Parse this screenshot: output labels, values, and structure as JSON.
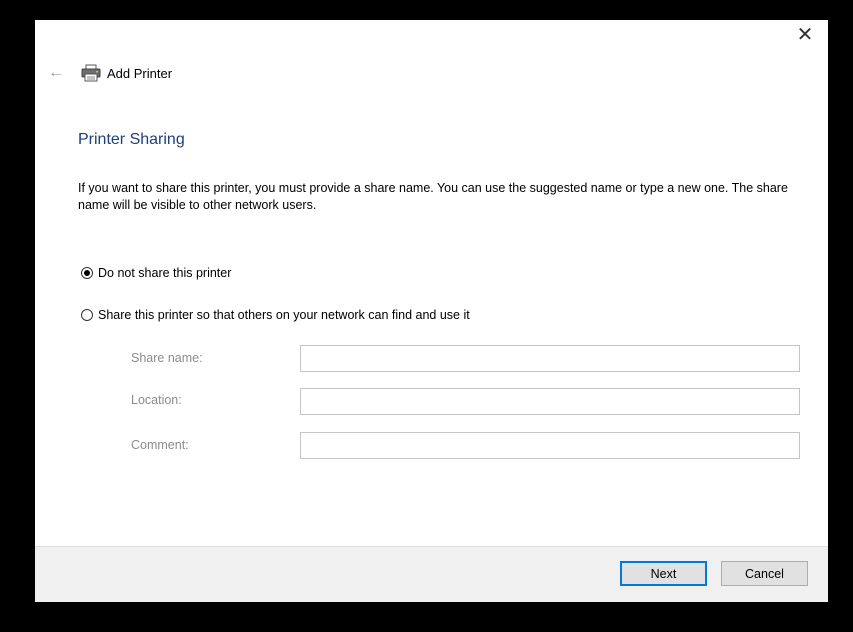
{
  "window": {
    "title": "Add Printer",
    "close_glyph": "✕",
    "back_glyph": "←",
    "icons": {
      "back": "back-arrow-icon",
      "printer": "printer-icon",
      "close": "close-icon"
    }
  },
  "page": {
    "heading": "Printer Sharing",
    "description": "If you want to share this printer, you must provide a share name. You can use the suggested name or type a new one. The share name will be visible to other network users."
  },
  "sharing_options": [
    {
      "label": "Do not share this printer",
      "selected": true
    },
    {
      "label": "Share this printer so that others on your network can find and use it",
      "selected": false
    }
  ],
  "fields": {
    "share_name": {
      "label": "Share name:",
      "value": ""
    },
    "location": {
      "label": "Location:",
      "value": ""
    },
    "comment": {
      "label": "Comment:",
      "value": ""
    }
  },
  "buttons": {
    "next": "Next",
    "cancel": "Cancel"
  },
  "colors": {
    "heading": "#1f3f78",
    "disabled_label": "#8c8c8c",
    "primary_button_border": "#0078d7",
    "footer_background": "#f0f0f0"
  }
}
